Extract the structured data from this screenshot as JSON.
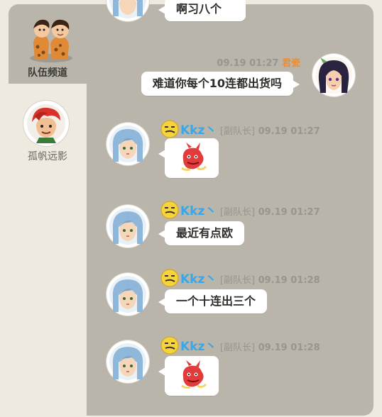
{
  "tabs": {
    "team_channel": "队伍频道"
  },
  "friends": [
    {
      "name": "孤帆远影"
    }
  ],
  "messages": [
    {
      "text": "啊习八个"
    },
    {
      "sender": "君瓷",
      "time": "09.19 01:27",
      "text": "难道你每个10连都出货吗",
      "mine": true
    },
    {
      "sender": "Kkz丶",
      "role": "[副队长]",
      "time": "09.19 01:27",
      "sticker": "red-dragon-sticker"
    },
    {
      "sender": "Kkz丶",
      "role": "[副队长]",
      "time": "09.19 01:27",
      "text": "最近有点欧"
    },
    {
      "sender": "Kkz丶",
      "role": "[副队长]",
      "time": "09.19 01:28",
      "text": "一个十连出三个"
    },
    {
      "sender": "Kkz丶",
      "role": "[副队长]",
      "time": "09.19 01:28",
      "sticker": "red-dragon-sticker"
    }
  ],
  "colors": {
    "panel": "#bab5aa",
    "sidebar": "#eeeadf",
    "my_name": "#f08c2c",
    "sender_name": "#3aa6e8"
  }
}
